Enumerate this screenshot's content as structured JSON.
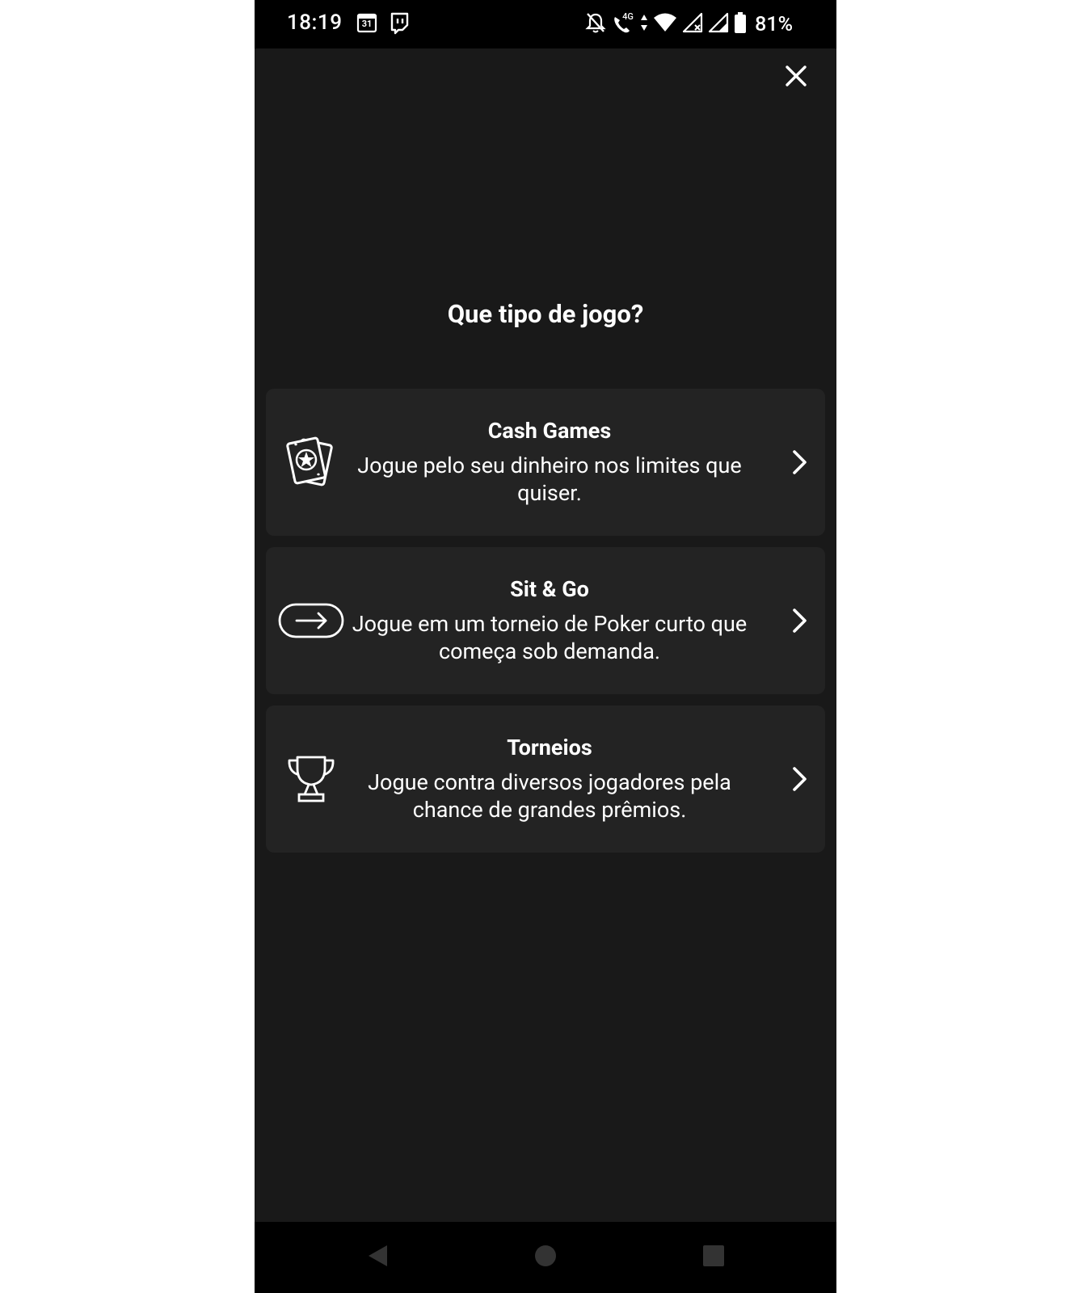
{
  "status_bar": {
    "time": "18:19",
    "calendar_day": "31",
    "network_type": "4G",
    "battery": "81%"
  },
  "close_label": "Fechar",
  "title": "Que tipo de jogo?",
  "options": [
    {
      "title": "Cash Games",
      "description": "Jogue pelo seu dinheiro nos limites que quiser.",
      "icon": "playing-cards-icon"
    },
    {
      "title": "Sit & Go",
      "description": "Jogue em um torneio de Poker curto que começa sob demanda.",
      "icon": "arrow-in-pill-icon"
    },
    {
      "title": "Torneios",
      "description": "Jogue contra diversos jogadores pela chance de grandes prêmios.",
      "icon": "trophy-icon"
    }
  ],
  "colors": {
    "background": "#191919",
    "card": "#232323",
    "text": "#ffffff",
    "system_bars": "#000000"
  }
}
